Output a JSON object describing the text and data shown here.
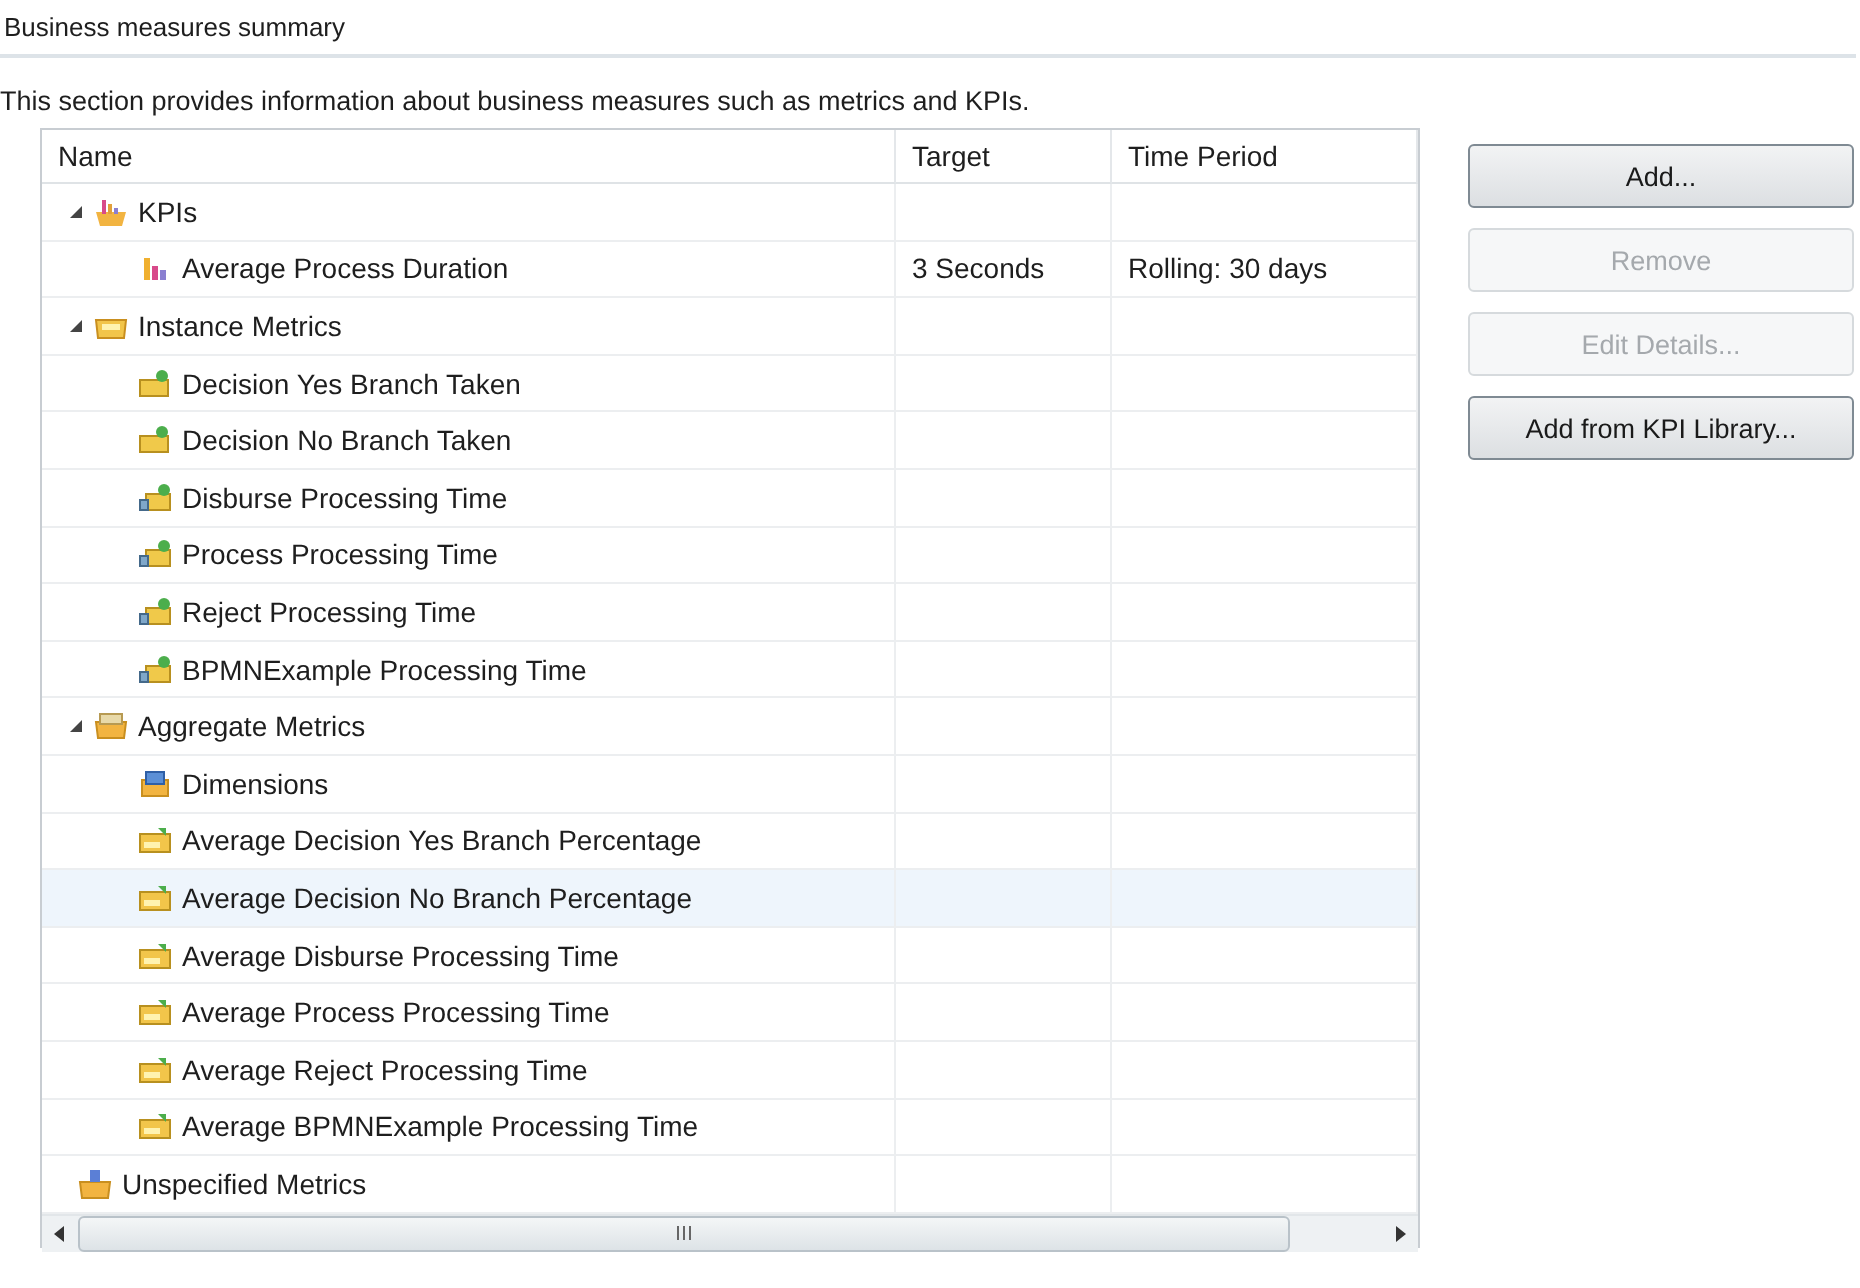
{
  "section": {
    "title": "Business measures summary",
    "description": "This section provides information about business measures such as metrics and KPIs."
  },
  "table": {
    "columns": [
      "Name",
      "Target",
      "Time Period"
    ],
    "rows": [
      {
        "name": "KPIs",
        "kind": "kpi-folder",
        "expanded": true,
        "selected": false,
        "children": [
          {
            "name": "Average Process Duration",
            "kind": "kpi",
            "target": "3 Seconds",
            "time_period": "Rolling: 30 days",
            "selected": false
          }
        ]
      },
      {
        "name": "Instance Metrics",
        "kind": "instance-folder",
        "expanded": true,
        "selected": false,
        "children": [
          {
            "name": "Decision Yes Branch Taken",
            "kind": "counter",
            "selected": false
          },
          {
            "name": "Decision No Branch Taken",
            "kind": "counter",
            "selected": false
          },
          {
            "name": "Disburse Processing Time",
            "kind": "timer",
            "selected": false
          },
          {
            "name": "Process Processing Time",
            "kind": "timer",
            "selected": false
          },
          {
            "name": "Reject Processing Time",
            "kind": "timer",
            "selected": false
          },
          {
            "name": "BPMNExample Processing Time",
            "kind": "timer",
            "selected": false
          }
        ]
      },
      {
        "name": "Aggregate Metrics",
        "kind": "aggregate-folder",
        "expanded": true,
        "selected": false,
        "children": [
          {
            "name": "Dimensions",
            "kind": "dimension",
            "selected": false
          },
          {
            "name": "Average Decision Yes Branch Percentage",
            "kind": "aggregate",
            "selected": false
          },
          {
            "name": "Average Decision No Branch Percentage",
            "kind": "aggregate",
            "selected": true
          },
          {
            "name": "Average Disburse Processing Time",
            "kind": "aggregate",
            "selected": false
          },
          {
            "name": "Average Process Processing Time",
            "kind": "aggregate",
            "selected": false
          },
          {
            "name": "Average Reject Processing Time",
            "kind": "aggregate",
            "selected": false
          },
          {
            "name": "Average BPMNExample Processing Time",
            "kind": "aggregate",
            "selected": false
          }
        ]
      },
      {
        "name": "Unspecified Metrics",
        "kind": "unspecified-folder",
        "selected": false
      }
    ]
  },
  "buttons": [
    {
      "label": "Add...",
      "disabled": false
    },
    {
      "label": "Remove",
      "disabled": true
    },
    {
      "label": "Edit Details...",
      "disabled": true
    },
    {
      "label": "Add from KPI Library...",
      "disabled": false
    }
  ]
}
